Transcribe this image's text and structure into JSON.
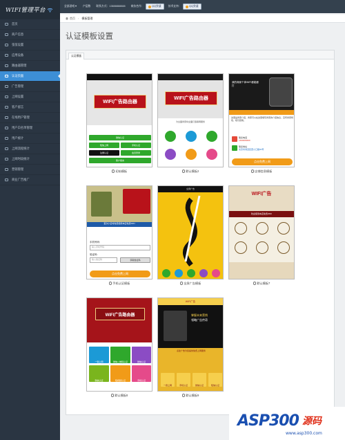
{
  "app": {
    "logo": "WIFI管理平台"
  },
  "topbar": {
    "items": [
      "全部游戏▼",
      "户层数",
      "联系方式：13888888888",
      "商务合作：",
      "技术支持："
    ],
    "qq_label": "QQ交谈"
  },
  "breadcrumb": {
    "home": "首页",
    "current": "模板管理"
  },
  "sidebar": {
    "items": [
      {
        "label": "首页",
        "active": false
      },
      {
        "label": "商户信息",
        "active": false
      },
      {
        "label": "弦弦设置",
        "active": false
      },
      {
        "label": "应用设备",
        "active": false
      },
      {
        "label": "路由器管理",
        "active": false
      },
      {
        "label": "认证页面",
        "active": true
      },
      {
        "label": "广告管理",
        "active": false
      },
      {
        "label": "上网设置",
        "active": false
      },
      {
        "label": "客户留言",
        "active": false
      },
      {
        "label": "在线用户管理",
        "active": false
      },
      {
        "label": "用户白名单管理",
        "active": false
      },
      {
        "label": "用户统计",
        "active": false
      },
      {
        "label": "上网流程统计",
        "active": false
      },
      {
        "label": "上网时段统计",
        "active": false
      },
      {
        "label": "营销管理",
        "active": false
      },
      {
        "label": "商业广告推广",
        "active": false
      }
    ]
  },
  "page": {
    "title": "认证模板设置",
    "tab": "认证模板"
  },
  "templates": [
    {
      "label": "初始模板"
    },
    {
      "label": "默认模板2"
    },
    {
      "label": "店铺信息模板"
    },
    {
      "label": "手机认证模板"
    },
    {
      "label": "全屏广告模板"
    },
    {
      "label": "默认模板7"
    },
    {
      "label": "默认模板8"
    },
    {
      "label": "默认模板9"
    }
  ],
  "previews": {
    "router_banner": "WIFI广告路由器",
    "t1_buttons": [
      "微信认证",
      "短信上网",
      "手机认证",
      "注册认证",
      "会员登录",
      "账户留言"
    ],
    "t2_sub": "为全面商家将全面打造联网服务",
    "t3_slogan": "我的商家个体WIFI都能都打",
    "t3_desc": "这里是商家介绍，商家可以在这里填写商家的介绍信息，宣传商家特色，吸引顾客。",
    "t3_phone": "联系电话",
    "t3_phone_no": "1888888888",
    "t3_addr": "联系地址",
    "t3_addr_val": "北京市海淀区西小口路66号",
    "t3_btn": "点击免费上网",
    "t4_notice": "首次小店将免费使用本店免费WIFI",
    "t4_phone_label": "手机号码:",
    "t4_phone_ph": "输入手机号码",
    "t4_code_label": "验证码:",
    "t4_code_ph": "输入验证码",
    "t4_code_btn": "获取验证码",
    "t4_btn": "点击免费上网",
    "t5_top": "全屏广告",
    "t6_brand": "WIFI广告",
    "t6_notice": "欢迎使用本店免费WIFI",
    "t8_cells": [
      "一键上网",
      "微信二维码认证",
      "微信认证",
      "微信认证",
      "短视频认证",
      "手机认证"
    ],
    "t9_top": "WIFI广告",
    "t9_head": "掌握未来营销",
    "t9_sub": "领略广告传奇",
    "t9_note": "点此广告为您提供免费上网服务",
    "t9_cells": [
      "一键上网",
      "手机认证",
      "微信认证",
      "短信认证"
    ]
  },
  "watermark": {
    "text": "ASP300",
    "suffix": "源码",
    "url": "www.asp300.com"
  },
  "colors": {
    "sidebar": "#2a3542",
    "active": "#3d8fd6",
    "topbar": "#34414e",
    "red": "#b8121a",
    "green": "#2fa82c",
    "orange": "#f19b18"
  }
}
